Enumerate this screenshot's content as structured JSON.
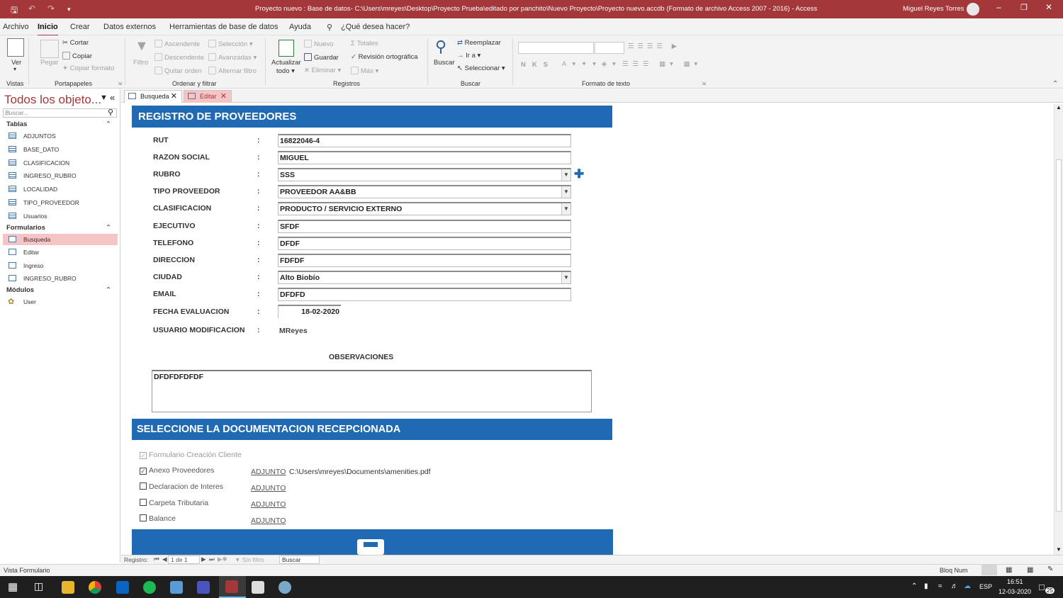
{
  "titlebar": {
    "title": "Proyecto nuevo : Base de datos- C:\\Users\\mreyes\\Desktop\\Proyecto Prueba\\editado por panchito\\Nuevo Proyecto\\Proyecto nuevo.accdb (Formato de archivo Access 2007 - 2016)  -  Access",
    "user": "Miguel Reyes Torres",
    "accent": "#a4373a"
  },
  "menu": {
    "tabs": [
      "Archivo",
      "Inicio",
      "Crear",
      "Datos externos",
      "Herramientas de base de datos",
      "Ayuda"
    ],
    "tell_me": "¿Qué desea hacer?"
  },
  "ribbon": {
    "ver": "Ver",
    "vistas": "Vistas",
    "pegar": "Pegar",
    "cortar": "Cortar",
    "copiar": "Copiar",
    "copiar_formato": "Copiar formato",
    "portapapeles": "Portapapeles",
    "filtro": "Filtro",
    "ascendente": "Ascendente",
    "descendente": "Descendente",
    "quitar_orden": "Quitar orden",
    "seleccion": "Selección",
    "avanzadas": "Avanzadas",
    "alternar_filtro": "Alternar filtro",
    "ordenar_filtrar": "Ordenar y filtrar",
    "actualizar": "Actualizar",
    "todo": "todo",
    "nuevo": "Nuevo",
    "guardar": "Guardar",
    "eliminar": "Eliminar",
    "totales": "Totales",
    "revision": "Revisión ortográfica",
    "mas": "Más",
    "registros": "Registros",
    "buscar": "Buscar",
    "reemplazar": "Reemplazar",
    "ir_a": "Ir a",
    "seleccionar": "Seleccionar",
    "buscar_group": "Buscar",
    "formato_texto": "Formato de texto"
  },
  "nav": {
    "title": "Todos los objeto...",
    "search_placeholder": "Buscar...",
    "tablas_label": "Tablas",
    "tablas": [
      "ADJUNTOS",
      "BASE_DATO",
      "CLASIFICACION",
      "INGRESO_RUBRO",
      "LOCALIDAD",
      "TIPO_PROVEEDOR",
      "Usuarios"
    ],
    "formularios_label": "Formularios",
    "formularios": [
      "Busqueda",
      "Editar",
      "Ingreso",
      "INGRESO_RUBRO"
    ],
    "modulos_label": "Módulos",
    "modulos": [
      "User"
    ]
  },
  "doctabs": [
    "Busqueda",
    "Editar"
  ],
  "form": {
    "header": "REGISTRO DE PROVEEDORES",
    "fields": [
      {
        "label": "RUT",
        "value": "16822046-4"
      },
      {
        "label": "RAZON SOCIAL",
        "value": "MIGUEL"
      },
      {
        "label": "RUBRO",
        "value": "SSS"
      },
      {
        "label": "TIPO PROVEEDOR",
        "value": "PROVEEDOR AA&BB"
      },
      {
        "label": "CLASIFICACION",
        "value": "PRODUCTO / SERVICIO EXTERNO"
      },
      {
        "label": "EJECUTIVO",
        "value": "SFDF"
      },
      {
        "label": "TELEFONO",
        "value": "DFDF"
      },
      {
        "label": "DIRECCION",
        "value": "FDFDF"
      },
      {
        "label": "CIUDAD",
        "value": "Alto Biobío"
      },
      {
        "label": "EMAIL",
        "value": "DFDFD"
      },
      {
        "label": "FECHA EVALUACION",
        "value": "18-02-2020"
      },
      {
        "label": "USUARIO MODIFICACION",
        "value": "MReyes"
      }
    ],
    "colon": ":",
    "observaciones_label": "OBSERVACIONES",
    "observaciones": "DFDFDFDFDF",
    "doc_header": "SELECCIONE LA DOCUMENTACION RECEPCIONADA",
    "docs": [
      {
        "label": "Formulario Creación Cliente",
        "checked": true,
        "disabled": true
      },
      {
        "label": "Anexo Proveedores",
        "checked": true,
        "link": "ADJUNTO",
        "path": "C:\\Users\\mreyes\\Documents\\amenities.pdf"
      },
      {
        "label": "Declaracion de Interes",
        "checked": false,
        "link": "ADJUNTO"
      },
      {
        "label": "Carpeta Tributaria",
        "checked": false,
        "link": "ADJUNTO"
      },
      {
        "label": "Balance",
        "checked": false,
        "link": "ADJUNTO"
      }
    ],
    "band_color": "#1f6ab2"
  },
  "recnav": {
    "registro": "Registro:",
    "position": "1 de 1",
    "sin_filtro": "Sin filtro",
    "buscar": "Buscar"
  },
  "status": {
    "left": "Vista Formulario",
    "right": "Bloq Num"
  },
  "taskbar": {
    "lang": "ESP",
    "time": "16:51",
    "date": "12-03-2020",
    "notif": "25"
  }
}
